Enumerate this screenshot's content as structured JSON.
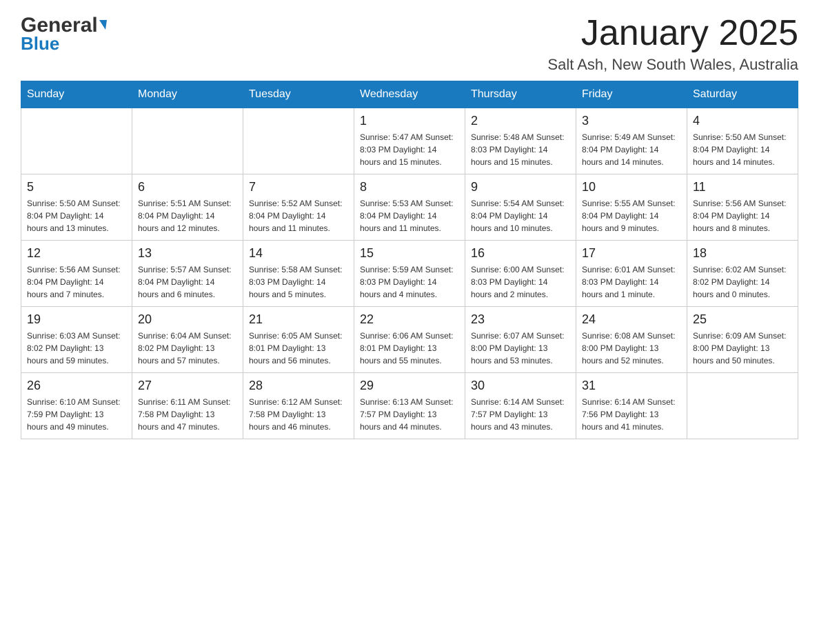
{
  "header": {
    "logo_general": "General",
    "logo_blue": "Blue",
    "month_title": "January 2025",
    "location": "Salt Ash, New South Wales, Australia"
  },
  "days_of_week": [
    "Sunday",
    "Monday",
    "Tuesday",
    "Wednesday",
    "Thursday",
    "Friday",
    "Saturday"
  ],
  "weeks": [
    [
      {
        "day": "",
        "info": ""
      },
      {
        "day": "",
        "info": ""
      },
      {
        "day": "",
        "info": ""
      },
      {
        "day": "1",
        "info": "Sunrise: 5:47 AM\nSunset: 8:03 PM\nDaylight: 14 hours\nand 15 minutes."
      },
      {
        "day": "2",
        "info": "Sunrise: 5:48 AM\nSunset: 8:03 PM\nDaylight: 14 hours\nand 15 minutes."
      },
      {
        "day": "3",
        "info": "Sunrise: 5:49 AM\nSunset: 8:04 PM\nDaylight: 14 hours\nand 14 minutes."
      },
      {
        "day": "4",
        "info": "Sunrise: 5:50 AM\nSunset: 8:04 PM\nDaylight: 14 hours\nand 14 minutes."
      }
    ],
    [
      {
        "day": "5",
        "info": "Sunrise: 5:50 AM\nSunset: 8:04 PM\nDaylight: 14 hours\nand 13 minutes."
      },
      {
        "day": "6",
        "info": "Sunrise: 5:51 AM\nSunset: 8:04 PM\nDaylight: 14 hours\nand 12 minutes."
      },
      {
        "day": "7",
        "info": "Sunrise: 5:52 AM\nSunset: 8:04 PM\nDaylight: 14 hours\nand 11 minutes."
      },
      {
        "day": "8",
        "info": "Sunrise: 5:53 AM\nSunset: 8:04 PM\nDaylight: 14 hours\nand 11 minutes."
      },
      {
        "day": "9",
        "info": "Sunrise: 5:54 AM\nSunset: 8:04 PM\nDaylight: 14 hours\nand 10 minutes."
      },
      {
        "day": "10",
        "info": "Sunrise: 5:55 AM\nSunset: 8:04 PM\nDaylight: 14 hours\nand 9 minutes."
      },
      {
        "day": "11",
        "info": "Sunrise: 5:56 AM\nSunset: 8:04 PM\nDaylight: 14 hours\nand 8 minutes."
      }
    ],
    [
      {
        "day": "12",
        "info": "Sunrise: 5:56 AM\nSunset: 8:04 PM\nDaylight: 14 hours\nand 7 minutes."
      },
      {
        "day": "13",
        "info": "Sunrise: 5:57 AM\nSunset: 8:04 PM\nDaylight: 14 hours\nand 6 minutes."
      },
      {
        "day": "14",
        "info": "Sunrise: 5:58 AM\nSunset: 8:03 PM\nDaylight: 14 hours\nand 5 minutes."
      },
      {
        "day": "15",
        "info": "Sunrise: 5:59 AM\nSunset: 8:03 PM\nDaylight: 14 hours\nand 4 minutes."
      },
      {
        "day": "16",
        "info": "Sunrise: 6:00 AM\nSunset: 8:03 PM\nDaylight: 14 hours\nand 2 minutes."
      },
      {
        "day": "17",
        "info": "Sunrise: 6:01 AM\nSunset: 8:03 PM\nDaylight: 14 hours\nand 1 minute."
      },
      {
        "day": "18",
        "info": "Sunrise: 6:02 AM\nSunset: 8:02 PM\nDaylight: 14 hours\nand 0 minutes."
      }
    ],
    [
      {
        "day": "19",
        "info": "Sunrise: 6:03 AM\nSunset: 8:02 PM\nDaylight: 13 hours\nand 59 minutes."
      },
      {
        "day": "20",
        "info": "Sunrise: 6:04 AM\nSunset: 8:02 PM\nDaylight: 13 hours\nand 57 minutes."
      },
      {
        "day": "21",
        "info": "Sunrise: 6:05 AM\nSunset: 8:01 PM\nDaylight: 13 hours\nand 56 minutes."
      },
      {
        "day": "22",
        "info": "Sunrise: 6:06 AM\nSunset: 8:01 PM\nDaylight: 13 hours\nand 55 minutes."
      },
      {
        "day": "23",
        "info": "Sunrise: 6:07 AM\nSunset: 8:00 PM\nDaylight: 13 hours\nand 53 minutes."
      },
      {
        "day": "24",
        "info": "Sunrise: 6:08 AM\nSunset: 8:00 PM\nDaylight: 13 hours\nand 52 minutes."
      },
      {
        "day": "25",
        "info": "Sunrise: 6:09 AM\nSunset: 8:00 PM\nDaylight: 13 hours\nand 50 minutes."
      }
    ],
    [
      {
        "day": "26",
        "info": "Sunrise: 6:10 AM\nSunset: 7:59 PM\nDaylight: 13 hours\nand 49 minutes."
      },
      {
        "day": "27",
        "info": "Sunrise: 6:11 AM\nSunset: 7:58 PM\nDaylight: 13 hours\nand 47 minutes."
      },
      {
        "day": "28",
        "info": "Sunrise: 6:12 AM\nSunset: 7:58 PM\nDaylight: 13 hours\nand 46 minutes."
      },
      {
        "day": "29",
        "info": "Sunrise: 6:13 AM\nSunset: 7:57 PM\nDaylight: 13 hours\nand 44 minutes."
      },
      {
        "day": "30",
        "info": "Sunrise: 6:14 AM\nSunset: 7:57 PM\nDaylight: 13 hours\nand 43 minutes."
      },
      {
        "day": "31",
        "info": "Sunrise: 6:14 AM\nSunset: 7:56 PM\nDaylight: 13 hours\nand 41 minutes."
      },
      {
        "day": "",
        "info": ""
      }
    ]
  ]
}
